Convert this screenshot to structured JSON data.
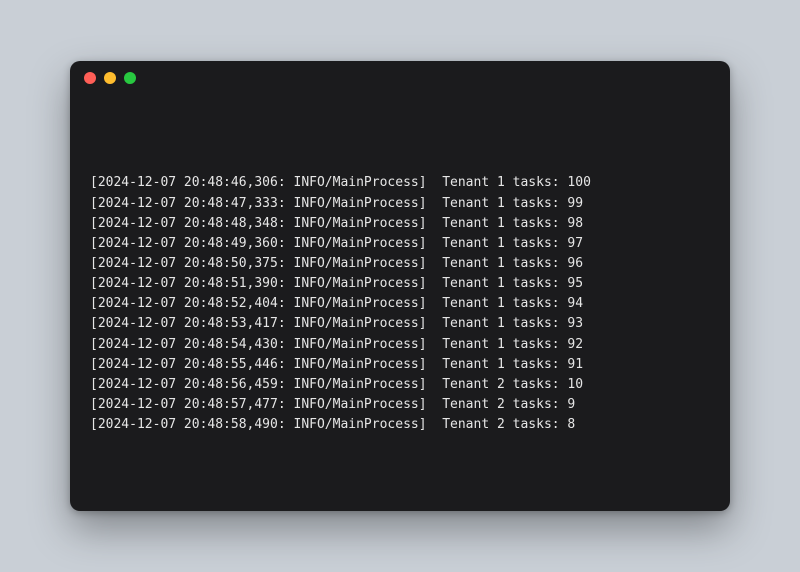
{
  "window": {
    "traffic_lights": {
      "close": "close",
      "minimize": "minimize",
      "zoom": "zoom"
    }
  },
  "log": {
    "lines": [
      {
        "text": "[2024-12-07 20:48:46,306: INFO/MainProcess]  Tenant 1 tasks: 100"
      },
      {
        "text": "[2024-12-07 20:48:47,333: INFO/MainProcess]  Tenant 1 tasks: 99"
      },
      {
        "text": "[2024-12-07 20:48:48,348: INFO/MainProcess]  Tenant 1 tasks: 98"
      },
      {
        "text": "[2024-12-07 20:48:49,360: INFO/MainProcess]  Tenant 1 tasks: 97"
      },
      {
        "text": "[2024-12-07 20:48:50,375: INFO/MainProcess]  Tenant 1 tasks: 96"
      },
      {
        "text": "[2024-12-07 20:48:51,390: INFO/MainProcess]  Tenant 1 tasks: 95"
      },
      {
        "text": "[2024-12-07 20:48:52,404: INFO/MainProcess]  Tenant 1 tasks: 94"
      },
      {
        "text": "[2024-12-07 20:48:53,417: INFO/MainProcess]  Tenant 1 tasks: 93"
      },
      {
        "text": "[2024-12-07 20:48:54,430: INFO/MainProcess]  Tenant 1 tasks: 92"
      },
      {
        "text": "[2024-12-07 20:48:55,446: INFO/MainProcess]  Tenant 1 tasks: 91"
      },
      {
        "text": "[2024-12-07 20:48:56,459: INFO/MainProcess]  Tenant 2 tasks: 10"
      },
      {
        "text": "[2024-12-07 20:48:57,477: INFO/MainProcess]  Tenant 2 tasks: 9"
      },
      {
        "text": "[2024-12-07 20:48:58,490: INFO/MainProcess]  Tenant 2 tasks: 8"
      }
    ]
  }
}
